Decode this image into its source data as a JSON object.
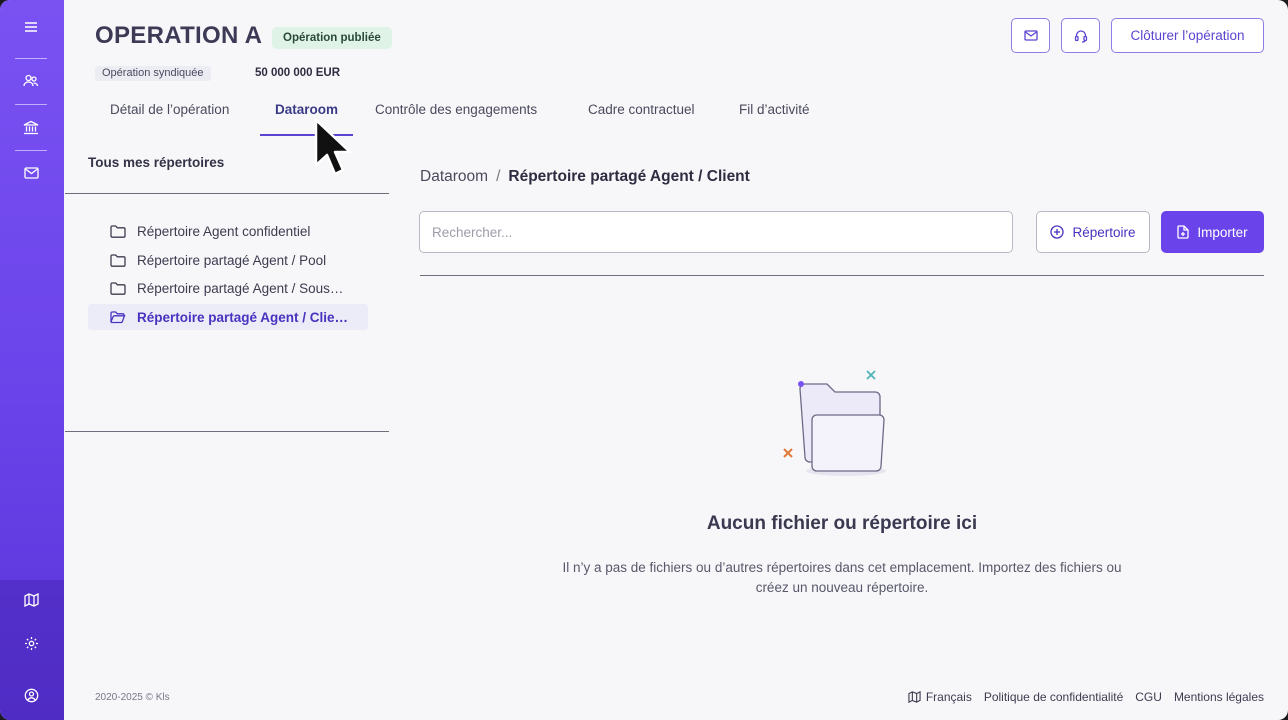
{
  "header": {
    "title": "OPERATION A",
    "status": "Opération publiée",
    "subtag": "Opération syndiquée",
    "amount": "50 000 000 EUR",
    "close_label": "Clôturer l’opération"
  },
  "tabs": [
    {
      "label": "Détail de l’opération"
    },
    {
      "label": "Dataroom"
    },
    {
      "label": "Contrôle des engagements"
    },
    {
      "label": "Cadre contractuel"
    },
    {
      "label": "Fil d’activité"
    }
  ],
  "sidebar": {
    "icons": [
      "menu-icon",
      "users-icon",
      "bank-icon",
      "mail-icon",
      "map-icon",
      "gear-icon",
      "user-circle-icon"
    ]
  },
  "left": {
    "title": "Tous mes répertoires",
    "folders": [
      {
        "label": "Répertoire Agent confidentiel"
      },
      {
        "label": "Répertoire partagé Agent / Pool"
      },
      {
        "label": "Répertoire partagé Agent / Sous…"
      },
      {
        "label": "Répertoire partagé Agent / Clie…"
      }
    ]
  },
  "main": {
    "breadcrumb_root": "Dataroom",
    "breadcrumb_sep": "/",
    "breadcrumb_current": "Répertoire partagé Agent / Client",
    "search_placeholder": "Rechercher...",
    "add_folder_label": "Répertoire",
    "import_label": "Importer",
    "empty_title": "Aucun fichier ou répertoire ici",
    "empty_desc": "Il n’y a pas de fichiers ou d’autres répertoires dans cet emplacement. Importez des fichiers ou créez un nouveau répertoire."
  },
  "footer": {
    "copyright": "2020-2025 © Kls",
    "language": "Français",
    "privacy": "Politique de confidentialité",
    "cgu": "CGU",
    "legal": "Mentions légales"
  },
  "colors": {
    "accent": "#6a43ea",
    "status_bg": "#dff3e6"
  }
}
